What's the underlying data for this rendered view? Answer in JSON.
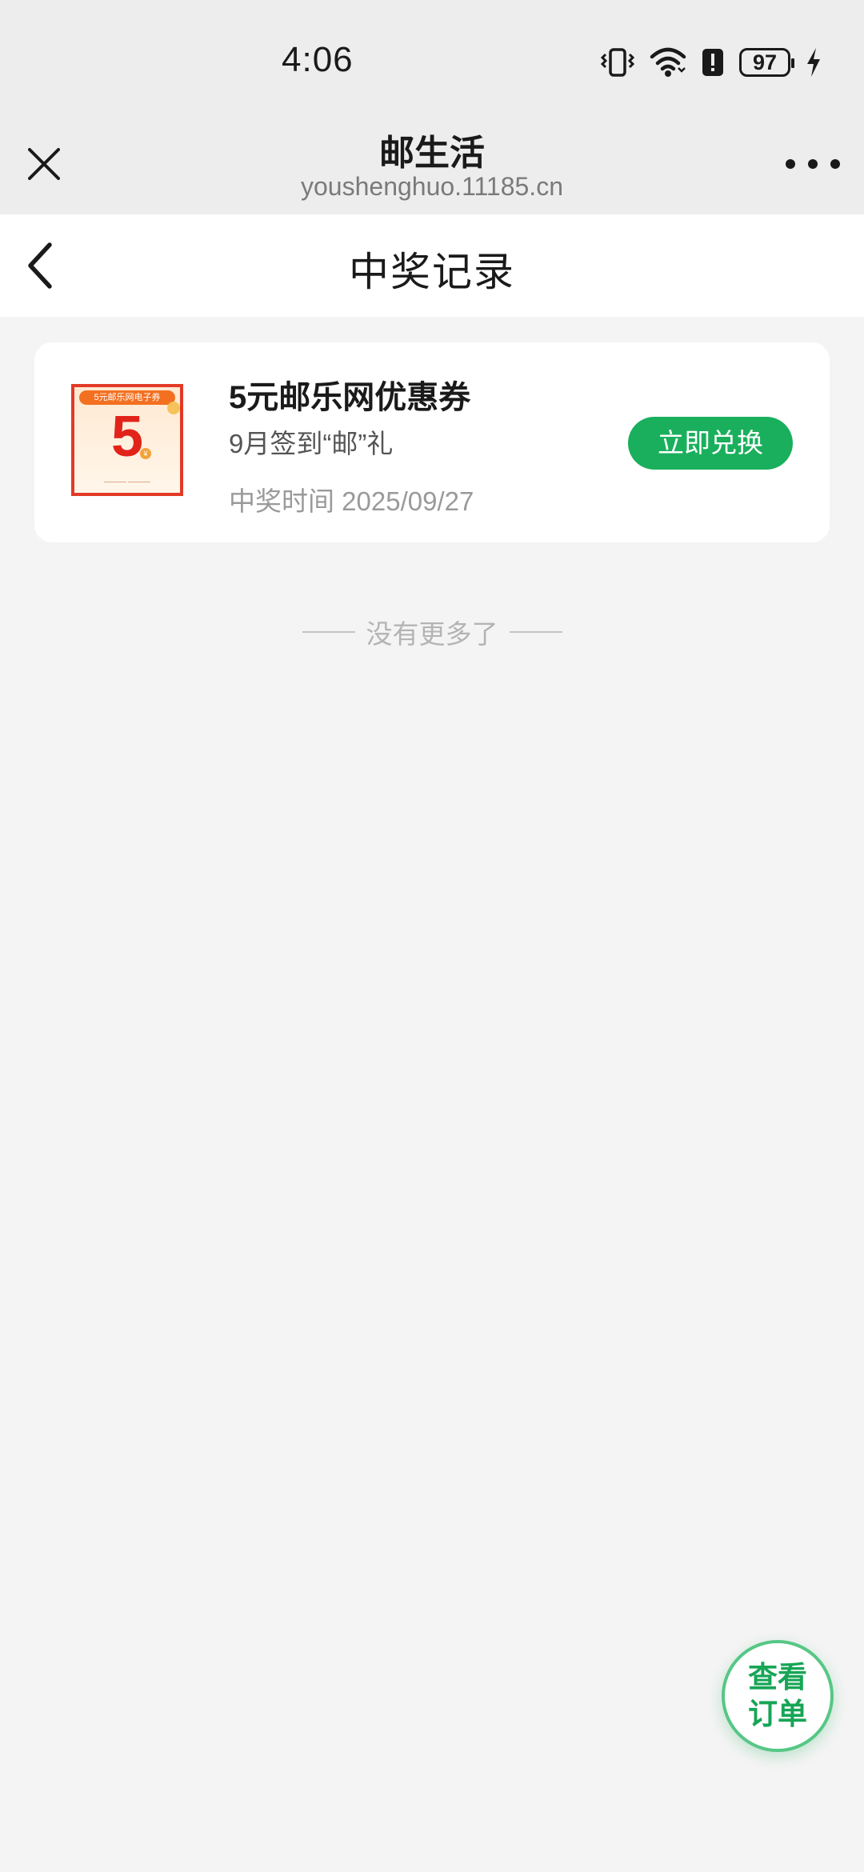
{
  "status_bar": {
    "time": "4:06",
    "battery_level": "97",
    "icons": [
      "vibrate-icon",
      "wifi-icon",
      "alert-icon",
      "battery-icon",
      "charging-icon"
    ]
  },
  "browser": {
    "title": "邮生活",
    "url": "youshenghuo.11185.cn"
  },
  "page": {
    "title": "中奖记录"
  },
  "prize": {
    "name": "5元邮乐网优惠券",
    "activity": "9月签到“邮”礼",
    "time": "中奖时间 2025/09/27",
    "redeem_label": "立即兑换",
    "coupon_image": {
      "banner": "5元邮乐网电子券",
      "amount": "5",
      "currency": "¥"
    }
  },
  "list_end": {
    "text": "没有更多了"
  },
  "fab": {
    "line1": "查看",
    "line2": "订单"
  },
  "colors": {
    "accent": "#1aaf5d",
    "coupon_red": "#e2231a",
    "header_bg": "#ededed",
    "page_bg": "#f4f4f4"
  }
}
